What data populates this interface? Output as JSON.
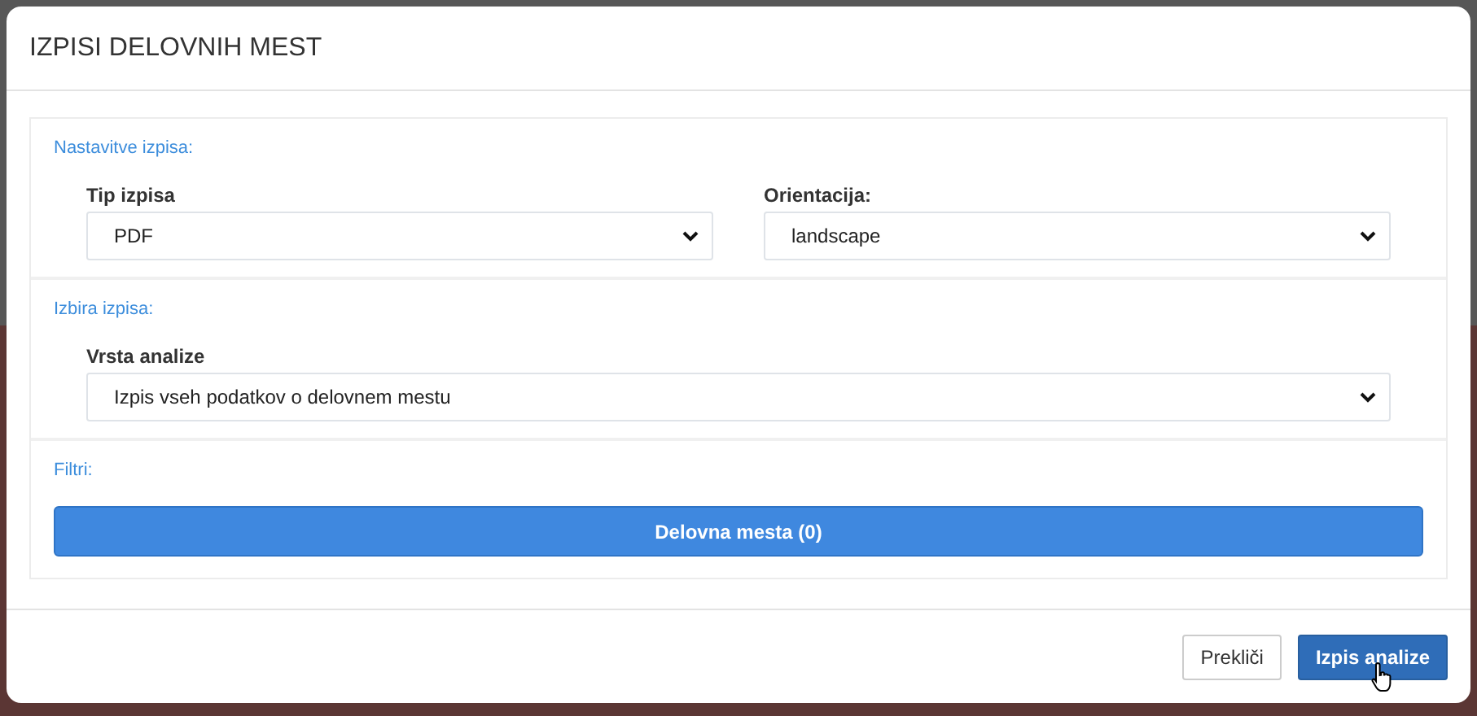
{
  "dialog": {
    "title": "IZPISI DELOVNIH MEST",
    "sections": [
      {
        "heading": "Nastavitve izpisa:",
        "fields": [
          {
            "label": "Tip izpisa",
            "value": "PDF"
          },
          {
            "label": "Orientacija:",
            "value": "landscape"
          }
        ]
      },
      {
        "heading": "Izbira izpisa:",
        "fields": [
          {
            "label": "Vrsta analize",
            "value": "Izpis vseh podatkov o delovnem mestu"
          }
        ]
      },
      {
        "heading": "Filtri:",
        "button": "Delovna mesta (0)"
      }
    ],
    "buttons": [
      {
        "label": "Prekliči",
        "kind": "secondary"
      },
      {
        "label": "Izpis analize",
        "kind": "primary"
      }
    ]
  }
}
